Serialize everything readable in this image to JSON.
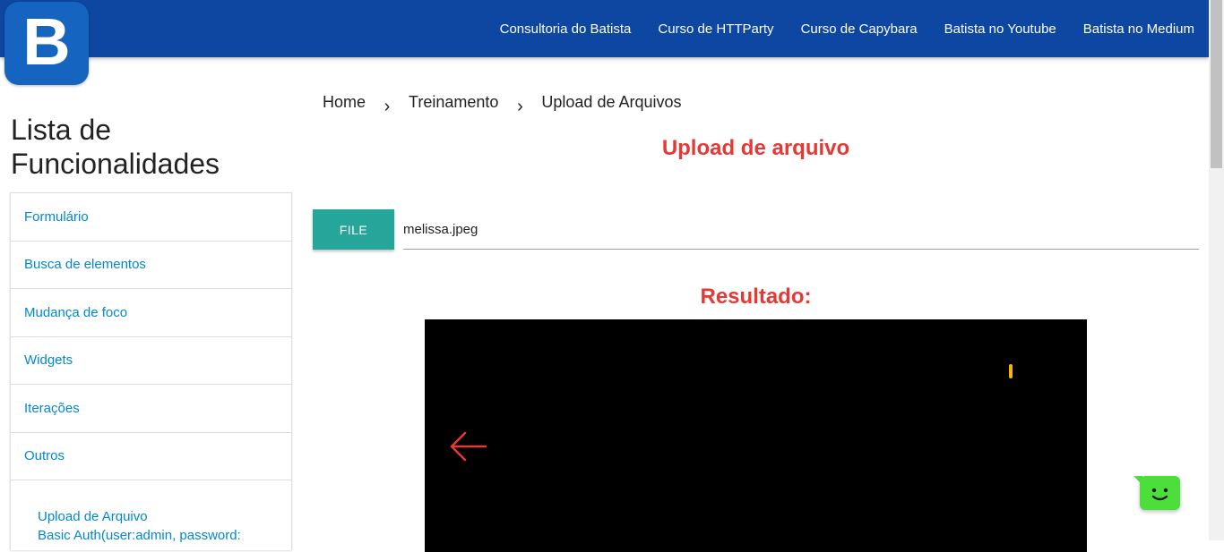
{
  "brand": {
    "logo_letter": "B"
  },
  "nav": {
    "items": [
      "Consultoria do Batista",
      "Curso de HTTParty",
      "Curso de Capybara",
      "Batista no Youtube",
      "Batista no Medium"
    ]
  },
  "sidebar": {
    "title_line1": "Lista de",
    "title_line2": "Funcionalidades",
    "items": [
      "Formulário",
      "Busca de elementos",
      "Mudança de foco",
      "Widgets",
      "Iterações",
      "Outros"
    ],
    "subitems": [
      "Upload de Arquivo",
      "Basic Auth(user:admin, password:"
    ]
  },
  "breadcrumb": {
    "items": [
      "Home",
      "Treinamento",
      "Upload de Arquivos"
    ],
    "separator": "›"
  },
  "main": {
    "heading": "Upload de arquivo",
    "file_button_label": "FILE",
    "file_path_value": "melissa.jpeg",
    "result_heading": "Resultado:"
  },
  "colors": {
    "topbar": "#0d47a1",
    "logo": "#1565c0",
    "accent_red": "#e53935",
    "link_blue": "#0288d1",
    "file_button": "#26a69a",
    "chat_widget": "#4cdf3c"
  },
  "icons": {
    "arrow": "arrow-left-icon",
    "chat": "chat-bot-icon"
  }
}
